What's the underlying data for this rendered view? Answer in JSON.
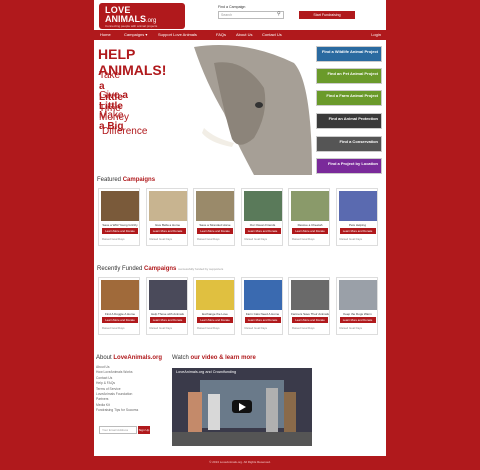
{
  "header": {
    "logo_line1": "LOVE",
    "logo_line2": "ANIMALS",
    "logo_suffix": ".org",
    "tagline": "Connecting people with animal projects",
    "find_label": "Find a Campaign",
    "search_placeholder": "Search",
    "start_button": "Start Fundraising",
    "nav": [
      "Home",
      "Campaigns ▾",
      "Support Love Animals",
      "FAQs",
      "About Us",
      "Contact Us"
    ],
    "login": "Login"
  },
  "hero": {
    "title": "HELP ANIMALS!",
    "lines": [
      {
        "pre": "Take ",
        "bold": "a Little",
        "post": " Time"
      },
      {
        "pre": "Give ",
        "bold": "a Little",
        "post": " Money"
      },
      {
        "pre": "Make ",
        "bold": "a Big",
        "post": ""
      },
      {
        "pre": "Difference",
        "bold": "",
        "post": ""
      }
    ]
  },
  "side_banners": [
    "Find a Wildlife Animal Project",
    "Find an Pet Animal Project",
    "Find a Farm Animal Project",
    "Find an Animal Protection",
    "Find a Conservation",
    "Find a Project by Location"
  ],
  "featured": {
    "title_pre": "Featured",
    "title_bold": "Campaigns",
    "items": [
      {
        "title": "Save a Wild Young Grizzly",
        "button": "Learn More and Donate",
        "stats": "Raised  Goal  Days"
      },
      {
        "title": "Give Bella a Home",
        "button": "Learn More and Donate",
        "stats": "Raised  Goal  Days"
      },
      {
        "title": "Save a Stranded Horse",
        "button": "Learn More and Donate",
        "stats": "Raised  Goal  Days"
      },
      {
        "title": "Our Ocean Friends",
        "button": "Learn More and Donate",
        "stats": "Raised  Goal  Days"
      },
      {
        "title": "Rescue a Cheetah",
        "button": "Learn More and Donate",
        "stats": "Raised  Goal  Days"
      },
      {
        "title": "Pets Helping",
        "button": "Learn More and Donate",
        "stats": "Raised  Goal  Days"
      }
    ]
  },
  "recent": {
    "title_pre": "Recently Funded",
    "title_bold": "Campaigns",
    "note": "successfully funded by supporters",
    "items": [
      {
        "title": "Find A Doggie A Home",
        "button": "Learn More and Donate",
        "stats": "Raised  Goal  Days"
      },
      {
        "title": "Help Those with Animals",
        "button": "Learn More and Donate",
        "stats": "Raised  Goal  Days"
      },
      {
        "title": "Exchange the Love",
        "button": "Learn More and Donate",
        "stats": "Raised  Goal  Days"
      },
      {
        "title": "Farm Cats Need A Home",
        "button": "Learn More and Donate",
        "stats": "Raised  Goal  Days"
      },
      {
        "title": "Farmers Save Their Animals",
        "button": "Learn More and Donate",
        "stats": "Raised  Goal  Days"
      },
      {
        "title": "Keep the Dogs Warm",
        "button": "Learn More and Donate",
        "stats": "Raised  Goal  Days"
      }
    ]
  },
  "about": {
    "title_pre": "About",
    "title_bold": "LoveAnimals.org",
    "links": [
      "About Us",
      "How LoveAnimals Works",
      "Contact Us",
      "Help & FAQs",
      "Terms of Service",
      "LoveAnimals Foundation",
      "Partners",
      "Media Kit",
      "Fundraising Tips for Success"
    ],
    "subscribe_placeholder": "Your Email Address",
    "subscribe_button": "Sign Up"
  },
  "video": {
    "title_pre": "Watch",
    "title_bold": "our video & learn more",
    "caption": "LoveAnimals.org and Crowdfunding"
  },
  "footer": "© 2013 LoveAnimals.org. All Rights Reserved.",
  "colors": {
    "brand": "#b0191c",
    "banner_green": "#6a9a2a",
    "banner_blue": "#2a6aa0",
    "banner_purple": "#7a2a9a"
  }
}
